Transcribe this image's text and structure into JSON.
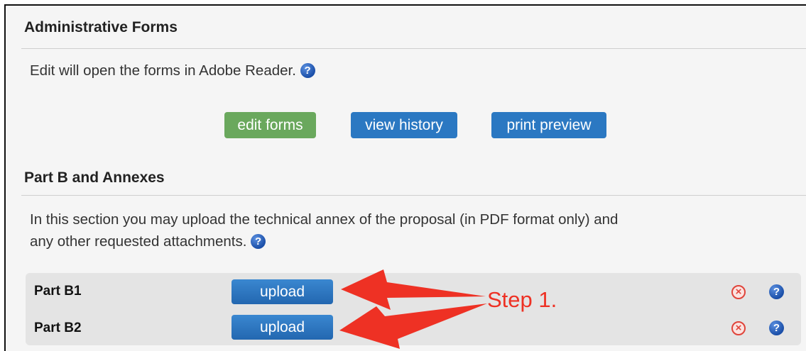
{
  "admin": {
    "heading": "Administrative Forms",
    "description": "Edit will open the forms in Adobe Reader.",
    "buttons": {
      "edit_forms": "edit forms",
      "view_history": "view history",
      "print_preview": "print preview"
    }
  },
  "partb": {
    "heading": "Part B and Annexes",
    "description_line1": "In this section you may upload the technical annex of the proposal (in PDF format only) and",
    "description_line2": "any other requested attachments.",
    "rows": [
      {
        "label": "Part B1",
        "upload_label": "upload"
      },
      {
        "label": "Part B2",
        "upload_label": "upload"
      }
    ]
  },
  "annotation": {
    "text": "Step 1.",
    "color": "#ee3124"
  },
  "icons": {
    "help": "question-mark",
    "remove": "x-circle"
  },
  "colors": {
    "green_button": "#6aa85d",
    "blue_button": "#2b78c2",
    "help_icon": "#1b4fa8",
    "remove_icon": "#e0443a"
  }
}
